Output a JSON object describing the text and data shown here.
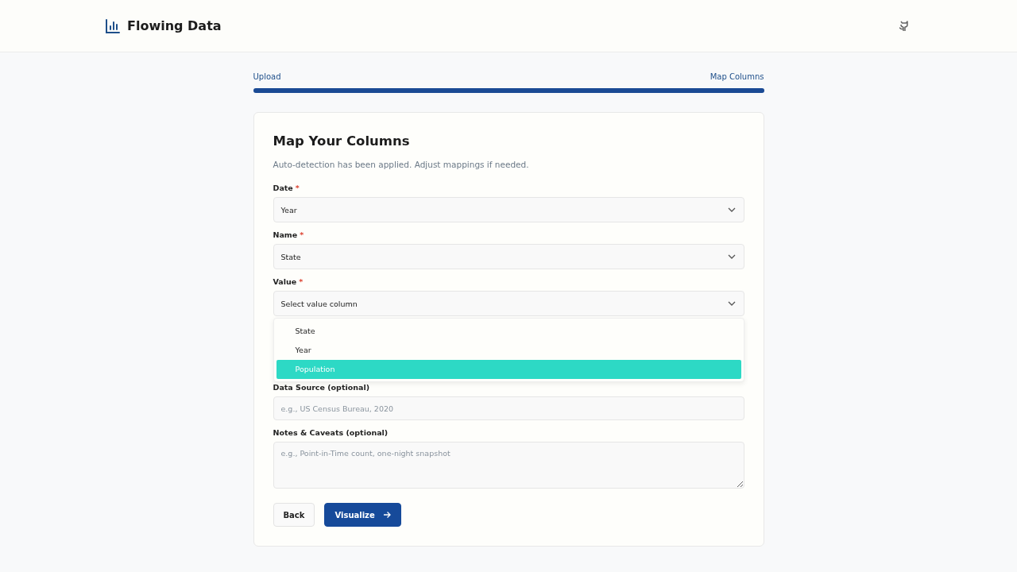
{
  "header": {
    "title": "Flowing Data"
  },
  "steps": {
    "labels": [
      "Upload",
      "Map Columns"
    ],
    "level": 1
  },
  "card": {
    "title": "Map Your Columns",
    "subtitle": "Auto-detection has been applied. Adjust mappings if needed.",
    "fields": [
      {
        "label": "Date",
        "required_mark": "*",
        "kind": "select",
        "value": "Year"
      },
      {
        "label": "Name",
        "required_mark": "*",
        "kind": "select",
        "value": "State"
      },
      {
        "label": "Value",
        "required_mark": "*",
        "kind": "select",
        "value": "Select value column",
        "open": true,
        "options": [
          {
            "label": "State",
            "selected": false
          },
          {
            "label": "Year",
            "selected": false
          },
          {
            "label": "Population",
            "selected": true
          }
        ]
      },
      {
        "label": "Data Source (optional)",
        "kind": "input",
        "placeholder": "e.g., US Census Bureau, 2020"
      },
      {
        "label": "Notes & Caveats (optional)",
        "kind": "textarea",
        "placeholder": "e.g., Point-in-Time count, one-night snapshot"
      }
    ],
    "buttons": [
      {
        "label": "Back",
        "kind": "secondary"
      },
      {
        "label": "Visualize",
        "kind": "primary"
      }
    ]
  }
}
